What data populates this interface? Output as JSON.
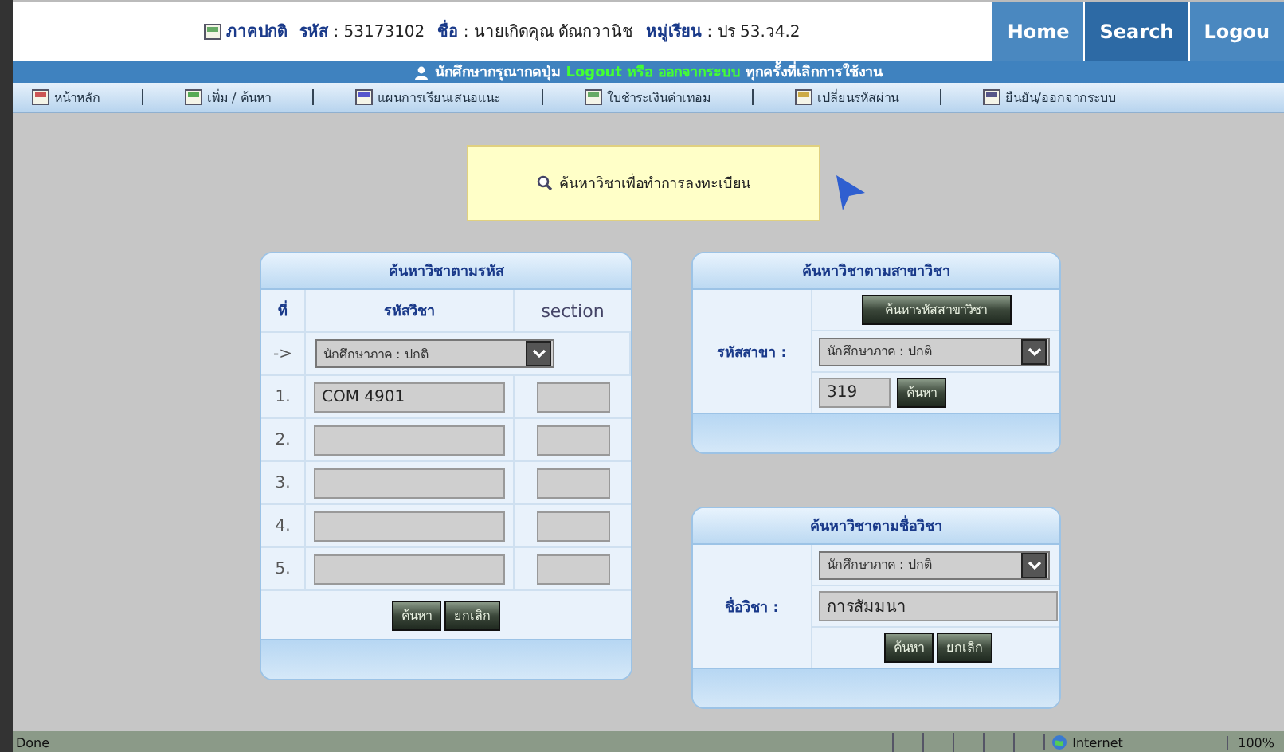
{
  "user_bar": {
    "program": "ภาคปกติ",
    "fields": [
      {
        "label": "รหัส",
        "value": ": 53173102"
      },
      {
        "label": "ชื่อ",
        "value": ": นายเกิดคุณ ดัณกวานิช"
      },
      {
        "label": "หมู่เรียน",
        "value": ": ปร 53.ว4.2"
      }
    ]
  },
  "nav_tabs": [
    {
      "label": "Home",
      "selected": false
    },
    {
      "label": "Search",
      "selected": true
    },
    {
      "label": "Logou",
      "selected": false
    }
  ],
  "notice": {
    "before": "นักศึกษากรุณากดปุ่ม",
    "highlight": "Logout หรือ ออกจากระบบ",
    "after": "ทุกครั้งที่เลิกการใช้งาน"
  },
  "menu": [
    "หน้าหลัก",
    "เพิ่ม / ค้นหา",
    "แผนการเรียนเสนอแนะ",
    "ใบชำระเงินค่าเทอม",
    "เปลี่ยนรหัสผ่าน",
    "ยืนยัน/ออกจากระบบ"
  ],
  "banner": "ค้นหาวิชาเพื่อทำการลงทะเบียน",
  "by_code": {
    "title": "ค้นหาวิชาตามรหัส",
    "columns": [
      "ที่",
      "รหัสวิชา",
      "section"
    ],
    "arrow": "->",
    "term": "นักศึกษาภาค : ปกติ",
    "rows": [
      {
        "no": "1.",
        "value": "COM 4901"
      },
      {
        "no": "2."
      },
      {
        "no": "3."
      },
      {
        "no": "4."
      },
      {
        "no": "5."
      }
    ],
    "buttons": [
      "ค้นหา",
      "ยกเลิก"
    ]
  },
  "by_major": {
    "title": "ค้นหาวิชาตามสาขาวิชา",
    "lookup_button": "ค้นหารหัสสาขาวิชา",
    "label": "รหัสสาขา :",
    "term": "นักศึกษาภาค : ปกติ",
    "value": "319",
    "button": "ค้นหา"
  },
  "by_name": {
    "title": "ค้นหาวิชาตามชื่อวิชา",
    "label": "ชื่อวิชา :",
    "term": "นักศึกษาภาค : ปกติ",
    "value": "การสัมมนา",
    "buttons": [
      "ค้นหา",
      "ยกเลิก"
    ]
  },
  "status_bar": {
    "text": "Done",
    "zone": "Internet",
    "zoom": "100%"
  }
}
